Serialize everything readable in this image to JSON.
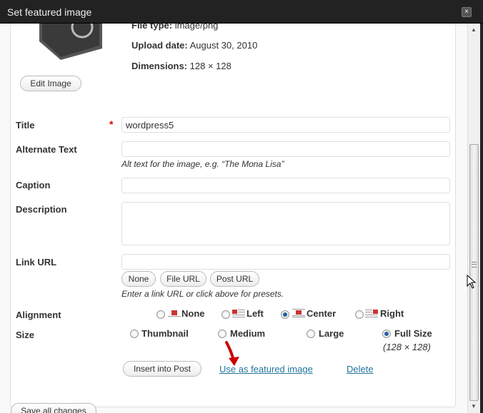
{
  "dialog": {
    "title": "Set featured image",
    "close_icon": "×"
  },
  "meta": {
    "file_type_label": "File type:",
    "file_type": "image/png",
    "upload_date_label": "Upload date:",
    "upload_date": "August 30, 2010",
    "dimensions_label": "Dimensions:",
    "dimensions": "128 × 128"
  },
  "edit_image_label": "Edit Image",
  "fields": {
    "title_label": "Title",
    "required_mark": "*",
    "title_value": "wordpress5",
    "alt_label": "Alternate Text",
    "alt_value": "",
    "alt_help": "Alt text for the image, e.g. “The Mona Lisa”",
    "caption_label": "Caption",
    "caption_value": "",
    "description_label": "Description",
    "description_value": "",
    "link_url_label": "Link URL",
    "link_url_value": "",
    "link_buttons": [
      "None",
      "File URL",
      "Post URL"
    ],
    "link_help": "Enter a link URL or click above for presets."
  },
  "alignment": {
    "label": "Alignment",
    "options": [
      "None",
      "Left",
      "Center",
      "Right"
    ],
    "selected": "Center"
  },
  "size": {
    "label": "Size",
    "options": [
      "Thumbnail",
      "Medium",
      "Large",
      "Full Size"
    ],
    "selected": "Full Size",
    "full_size_dims": "(128 × 128)"
  },
  "actions": {
    "insert_label": "Insert into Post",
    "featured_label": "Use as featured image",
    "delete_label": "Delete",
    "save_all_label": "Save all changes"
  },
  "colors": {
    "accent": "#21759b",
    "required": "#dd0000",
    "titlebar": "#222222",
    "annotation_arrow": "#cc0000"
  }
}
